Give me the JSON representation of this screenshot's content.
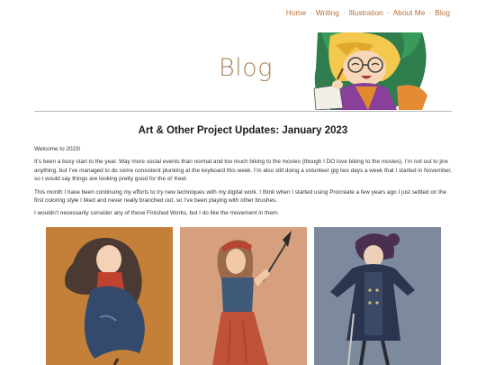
{
  "nav": {
    "items": [
      "Home",
      "Writing",
      "Illustration",
      "About Me",
      "Blog"
    ],
    "separator": "·"
  },
  "hero": {
    "title": "Blog"
  },
  "post": {
    "title": "Art & Other Project Updates: January 2023",
    "paragraphs": [
      "Welcome to 2023!",
      "It’s been a busy start to the year. Way more social events than normal and too much biking to the movies (though I DO love biking to the movies). I’m not out to jinx anything, but I’ve managed to do some consistent plunking at the keyboard this week. I’m also still doing a volunteer gig two days a week that I started in November, so I would say things are looking pretty good for the ol’ Keel.",
      "This month I have been continuing my efforts to try new techniques with my digital work. I think when I started using Procreate a few years ago I just settled on the first coloring style I liked and never really branched out, so I’ve been playing with other brushes.",
      "I wouldn’t necessarily consider any of these Finished Works, but I do like the movement in them."
    ]
  },
  "colors": {
    "accent": "#b5713d",
    "title": "#a9855a",
    "art1_bg": "#c8853e",
    "art2_bg": "#d6a07e",
    "art3_bg": "#7d8a9d"
  }
}
